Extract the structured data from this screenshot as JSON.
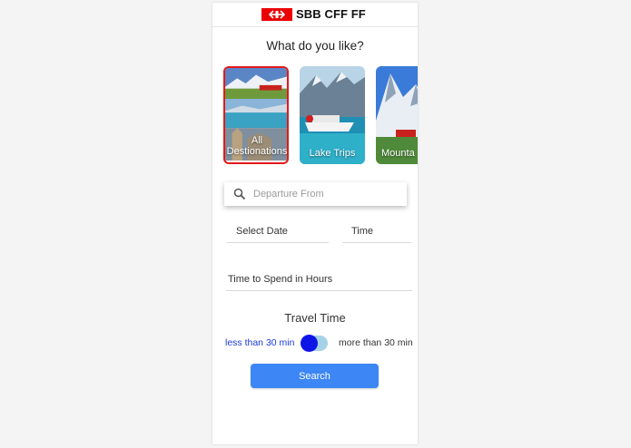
{
  "header": {
    "logo_text": "SBB CFF FF",
    "logo_color": "#eb0000"
  },
  "question": "What do you like?",
  "categories": [
    {
      "label": "All Destionations",
      "selected": true
    },
    {
      "label": "Lake Trips",
      "selected": false
    },
    {
      "label": "Mounta",
      "selected": false
    }
  ],
  "search": {
    "placeholder": "Departure From",
    "icon": "search-icon"
  },
  "fields": {
    "date_label": "Select Date",
    "time_label": "Time",
    "hours_label": "Time to Spend in Hours"
  },
  "travel_time": {
    "title": "Travel Time",
    "option_left": "less than 30 min",
    "option_right": "more than 30 min",
    "active_color": "#1a3ad8"
  },
  "search_button": "Search",
  "accent": "#3d86f5",
  "selection_color": "#e3191b"
}
